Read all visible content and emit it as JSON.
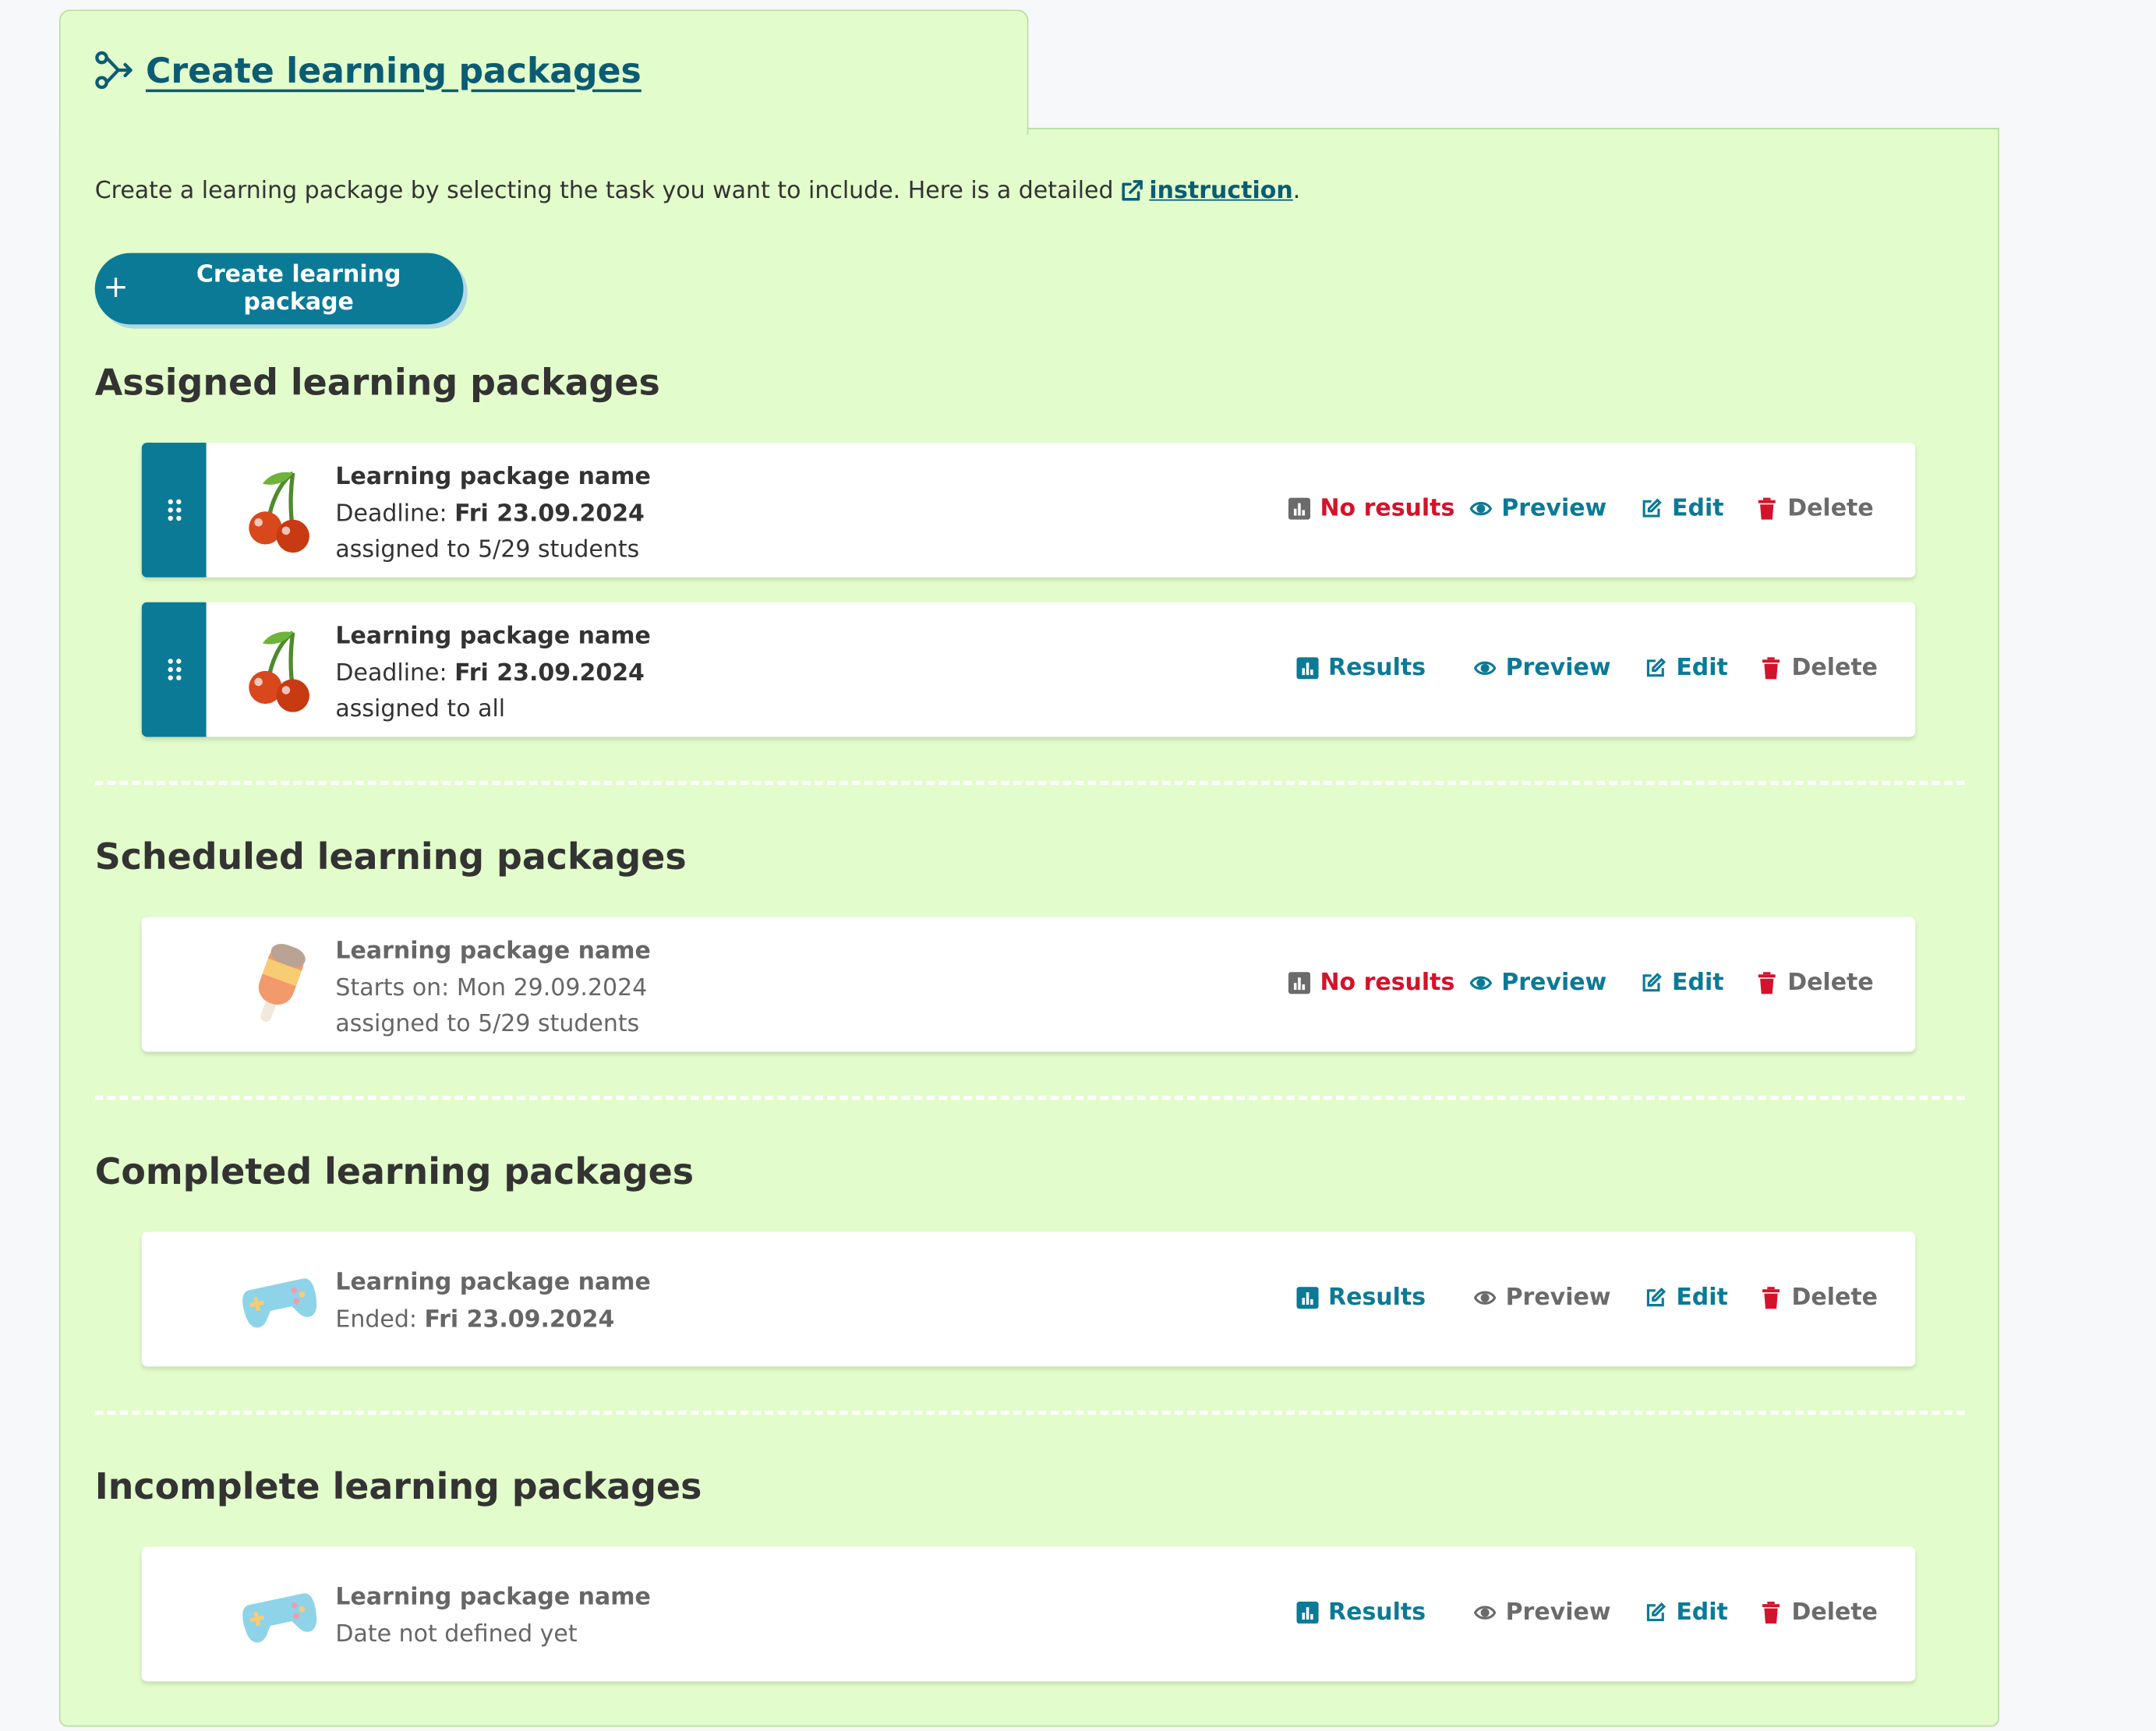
{
  "tab": {
    "title": "Create learning packages"
  },
  "intro": {
    "text": "Create a learning package by selecting the task you want to include. Here is a detailed",
    "link": "instruction",
    "end": "."
  },
  "create_button": {
    "label": "Create learning package",
    "plus": "+"
  },
  "colors": {
    "accent": "#0b7a96",
    "panel": "#e2fccb",
    "danger": "#d3132c",
    "muted": "#6b6b6b"
  },
  "sections": {
    "assigned": {
      "title": "Assigned learning packages"
    },
    "scheduled": {
      "title": "Scheduled learning packages"
    },
    "completed": {
      "title": "Completed learning packages"
    },
    "incomplete": {
      "title": "Incomplete learning packages"
    }
  },
  "cards": [
    {
      "icon": "cherry-icon",
      "name": "Learning package name",
      "line2_label": "Deadline: ",
      "line2_value": "Fri 23.09.2024",
      "line3": "assigned to 5/29 students",
      "results": "No results",
      "preview": "Preview",
      "edit": "Edit",
      "delete": "Delete"
    },
    {
      "icon": "cherry-icon",
      "name": "Learning package name",
      "line2_label": "Deadline: ",
      "line2_value": "Fri 23.09.2024",
      "line3": "assigned to all",
      "results": "Results",
      "preview": "Preview",
      "edit": "Edit",
      "delete": "Delete"
    },
    {
      "icon": "popsicle-icon",
      "name": "Learning package name",
      "line2_label": "Starts on: Mon 29.09.2024",
      "line2_value": "",
      "line3": "assigned to 5/29 students",
      "results": "No results",
      "preview": "Preview",
      "edit": "Edit",
      "delete": "Delete"
    },
    {
      "icon": "gamepad-icon",
      "name": "Learning package name",
      "line2_label": "Ended: ",
      "line2_value": "Fri 23.09.2024",
      "line3": "",
      "results": "Results",
      "preview": "Preview",
      "edit": "Edit",
      "delete": "Delete"
    },
    {
      "icon": "gamepad-icon",
      "name": "Learning package name",
      "line2_label": "Date not defined yet",
      "line2_value": "",
      "line3": "",
      "results": "Results",
      "preview": "Preview",
      "edit": "Edit",
      "delete": "Delete"
    }
  ]
}
